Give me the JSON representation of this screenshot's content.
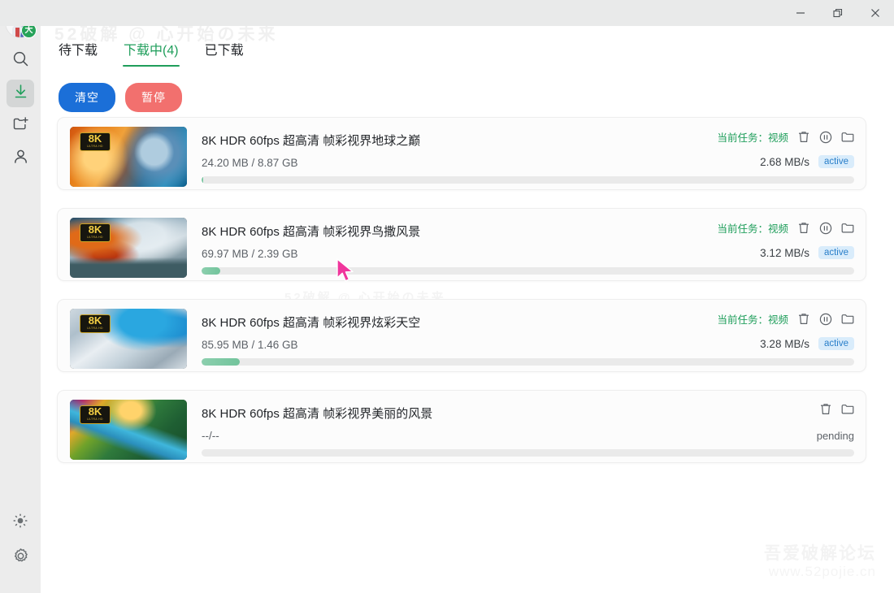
{
  "window": {
    "minimize_label": "minimize",
    "maximize_label": "restore",
    "close_label": "close"
  },
  "sidebar": {
    "avatar_badge": "大",
    "items": [
      {
        "name": "search",
        "label": "搜索"
      },
      {
        "name": "downloads",
        "label": "下载",
        "selected": true
      },
      {
        "name": "new-task",
        "label": "新建任务"
      },
      {
        "name": "account",
        "label": "账户"
      }
    ],
    "bottom_items": [
      {
        "name": "theme",
        "label": "主题"
      },
      {
        "name": "settings",
        "label": "设置"
      }
    ]
  },
  "tabs": [
    {
      "label": "待下载",
      "selected": false
    },
    {
      "label": "下载中(4)",
      "selected": true
    },
    {
      "label": "已下载",
      "selected": false
    }
  ],
  "toolbar": {
    "clear_label": "清空",
    "pause_label": "暂停"
  },
  "colors": {
    "accent_green": "#1f9e5b",
    "btn_blue": "#1b6fd8",
    "btn_red": "#f2706e",
    "badge_blue_bg": "#d9ecfb",
    "badge_blue_text": "#2a7fc9",
    "progress_fill": "#8ccfae",
    "progress_track": "#eaeaea"
  },
  "downloads": [
    {
      "title": "8K HDR 60fps 超高清 帧彩视界地球之巅",
      "size": "24.20 MB / 8.87 GB",
      "task_label": "当前任务：视频",
      "speed": "2.68 MB/s",
      "status": "active",
      "progress_pct": 0.3,
      "thumb_badge": "8K",
      "thumb_badge_sub": "ULTRA HD",
      "thumb_theme": "earth-space"
    },
    {
      "title": "8K HDR 60fps 超高清 帧彩视界鸟撒风景",
      "size": "69.97 MB / 2.39 GB",
      "task_label": "当前任务：视频",
      "speed": "3.12 MB/s",
      "status": "active",
      "progress_pct": 2.9,
      "thumb_badge": "8K",
      "thumb_badge_sub": "ULTRA HD",
      "thumb_theme": "stormy-coast"
    },
    {
      "title": "8K HDR 60fps 超高清 帧彩视界炫彩天空",
      "size": "85.95 MB / 1.46 GB",
      "task_label": "当前任务：视频",
      "speed": "3.28 MB/s",
      "status": "active",
      "progress_pct": 5.8,
      "thumb_badge": "8K",
      "thumb_badge_sub": "ULTRA HD",
      "thumb_theme": "snow-mountain"
    },
    {
      "title": "8K HDR 60fps 超高清 帧彩视界美丽的风景",
      "size": "--/--",
      "task_label": "",
      "speed": "",
      "status": "pending",
      "progress_pct": 0,
      "thumb_badge": "8K",
      "thumb_badge_sub": "ULTRA HD",
      "thumb_theme": "green-valley"
    }
  ],
  "watermarks": {
    "top": "52破解 @ 心开始の未来",
    "mid": "52破解 @ 心开始の未来",
    "bottom_line1": "吾爱破解论坛",
    "bottom_line2": "www.52pojie.cn"
  }
}
